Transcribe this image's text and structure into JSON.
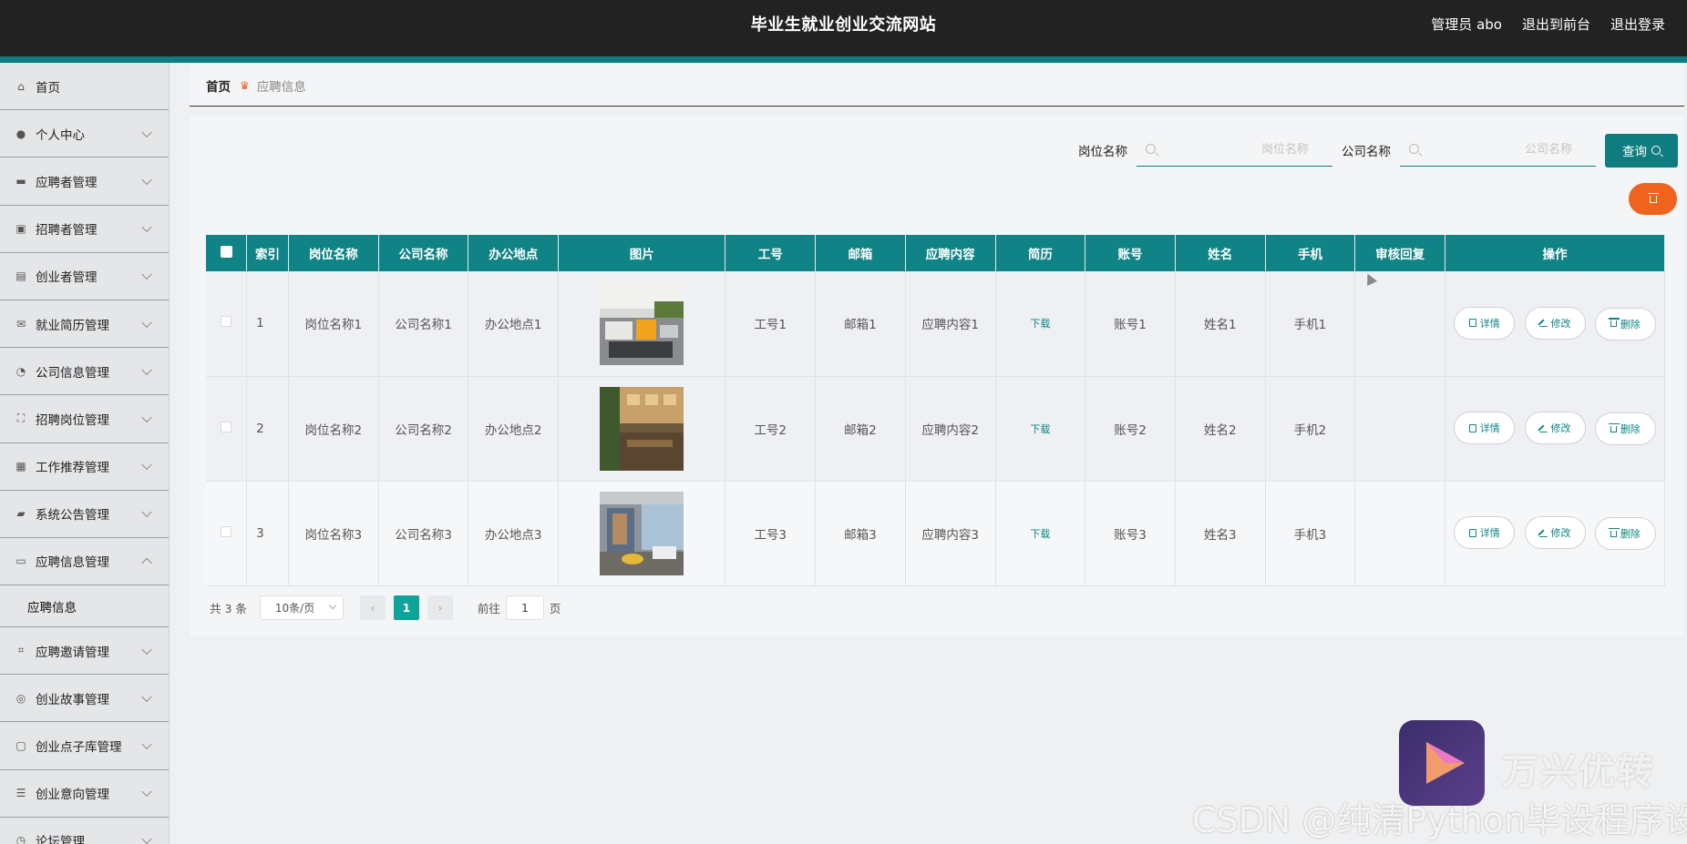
{
  "header": {
    "site_title": "毕业生就业创业交流网站",
    "user_label": "管理员 abo",
    "to_front": "退出到前台",
    "logout": "退出登录"
  },
  "sidebar": {
    "items": [
      {
        "label": "首页",
        "icon": "home-icon",
        "expandable": false
      },
      {
        "label": "个人中心",
        "icon": "user-icon",
        "expandable": true
      },
      {
        "label": "应聘者管理",
        "icon": "monitor-icon",
        "expandable": true
      },
      {
        "label": "招聘者管理",
        "icon": "recruiter-icon",
        "expandable": true
      },
      {
        "label": "创业者管理",
        "icon": "clipboard-icon",
        "expandable": true
      },
      {
        "label": "就业简历管理",
        "icon": "mail-icon",
        "expandable": true
      },
      {
        "label": "公司信息管理",
        "icon": "compass-icon",
        "expandable": true
      },
      {
        "label": "招聘岗位管理",
        "icon": "frame-icon",
        "expandable": true
      },
      {
        "label": "工作推荐管理",
        "icon": "clipboard-check-icon",
        "expandable": true
      },
      {
        "label": "系统公告管理",
        "icon": "briefcase-icon",
        "expandable": true
      },
      {
        "label": "应聘信息管理",
        "icon": "card-icon",
        "expandable": true,
        "open": true,
        "children": [
          "应聘信息"
        ]
      },
      {
        "label": "应聘邀请管理",
        "icon": "crop-icon",
        "expandable": true
      },
      {
        "label": "创业故事管理",
        "icon": "help-icon",
        "expandable": true
      },
      {
        "label": "创业点子库管理",
        "icon": "chat-icon",
        "expandable": true
      },
      {
        "label": "创业意向管理",
        "icon": "list-icon",
        "expandable": true
      },
      {
        "label": "论坛管理",
        "icon": "clock-icon",
        "expandable": true
      }
    ]
  },
  "breadcrumb": {
    "home": "首页",
    "current": "应聘信息"
  },
  "search": {
    "field1_label": "岗位名称",
    "field1_placeholder": "岗位名称",
    "field2_label": "公司名称",
    "field2_placeholder": "公司名称",
    "query_label": "查询"
  },
  "table": {
    "columns": [
      "索引",
      "岗位名称",
      "公司名称",
      "办公地点",
      "图片",
      "工号",
      "邮箱",
      "应聘内容",
      "简历",
      "账号",
      "姓名",
      "手机",
      "审核回复",
      "操作"
    ],
    "rows": [
      {
        "index": "1",
        "position": "岗位名称1",
        "company": "公司名称1",
        "location": "办公地点1",
        "image": "office-photo-1",
        "job_no": "工号1",
        "email": "邮箱1",
        "content": "应聘内容1",
        "resume": "下载",
        "account": "账号1",
        "name": "姓名1",
        "phone": "手机1",
        "reply": ""
      },
      {
        "index": "2",
        "position": "岗位名称2",
        "company": "公司名称2",
        "location": "办公地点2",
        "image": "office-photo-2",
        "job_no": "工号2",
        "email": "邮箱2",
        "content": "应聘内容2",
        "resume": "下载",
        "account": "账号2",
        "name": "姓名2",
        "phone": "手机2",
        "reply": ""
      },
      {
        "index": "3",
        "position": "岗位名称3",
        "company": "公司名称3",
        "location": "办公地点3",
        "image": "office-photo-3",
        "job_no": "工号3",
        "email": "邮箱3",
        "content": "应聘内容3",
        "resume": "下载",
        "account": "账号3",
        "name": "姓名3",
        "phone": "手机3",
        "reply": ""
      }
    ],
    "actions": {
      "detail": "详情",
      "edit": "修改",
      "delete": "删除"
    }
  },
  "pagination": {
    "total": "共 3 条",
    "page_size": "10条/页",
    "current_page": "1",
    "goto_label": "前往",
    "goto_value": "1",
    "page_suffix": "页"
  },
  "watermark": {
    "brand": "万兴优转",
    "credit": "CSDN @纯清Python毕设程序设计"
  },
  "colors": {
    "accent": "#0f7d80",
    "danger": "#f0631e",
    "header_bg": "#222222"
  }
}
